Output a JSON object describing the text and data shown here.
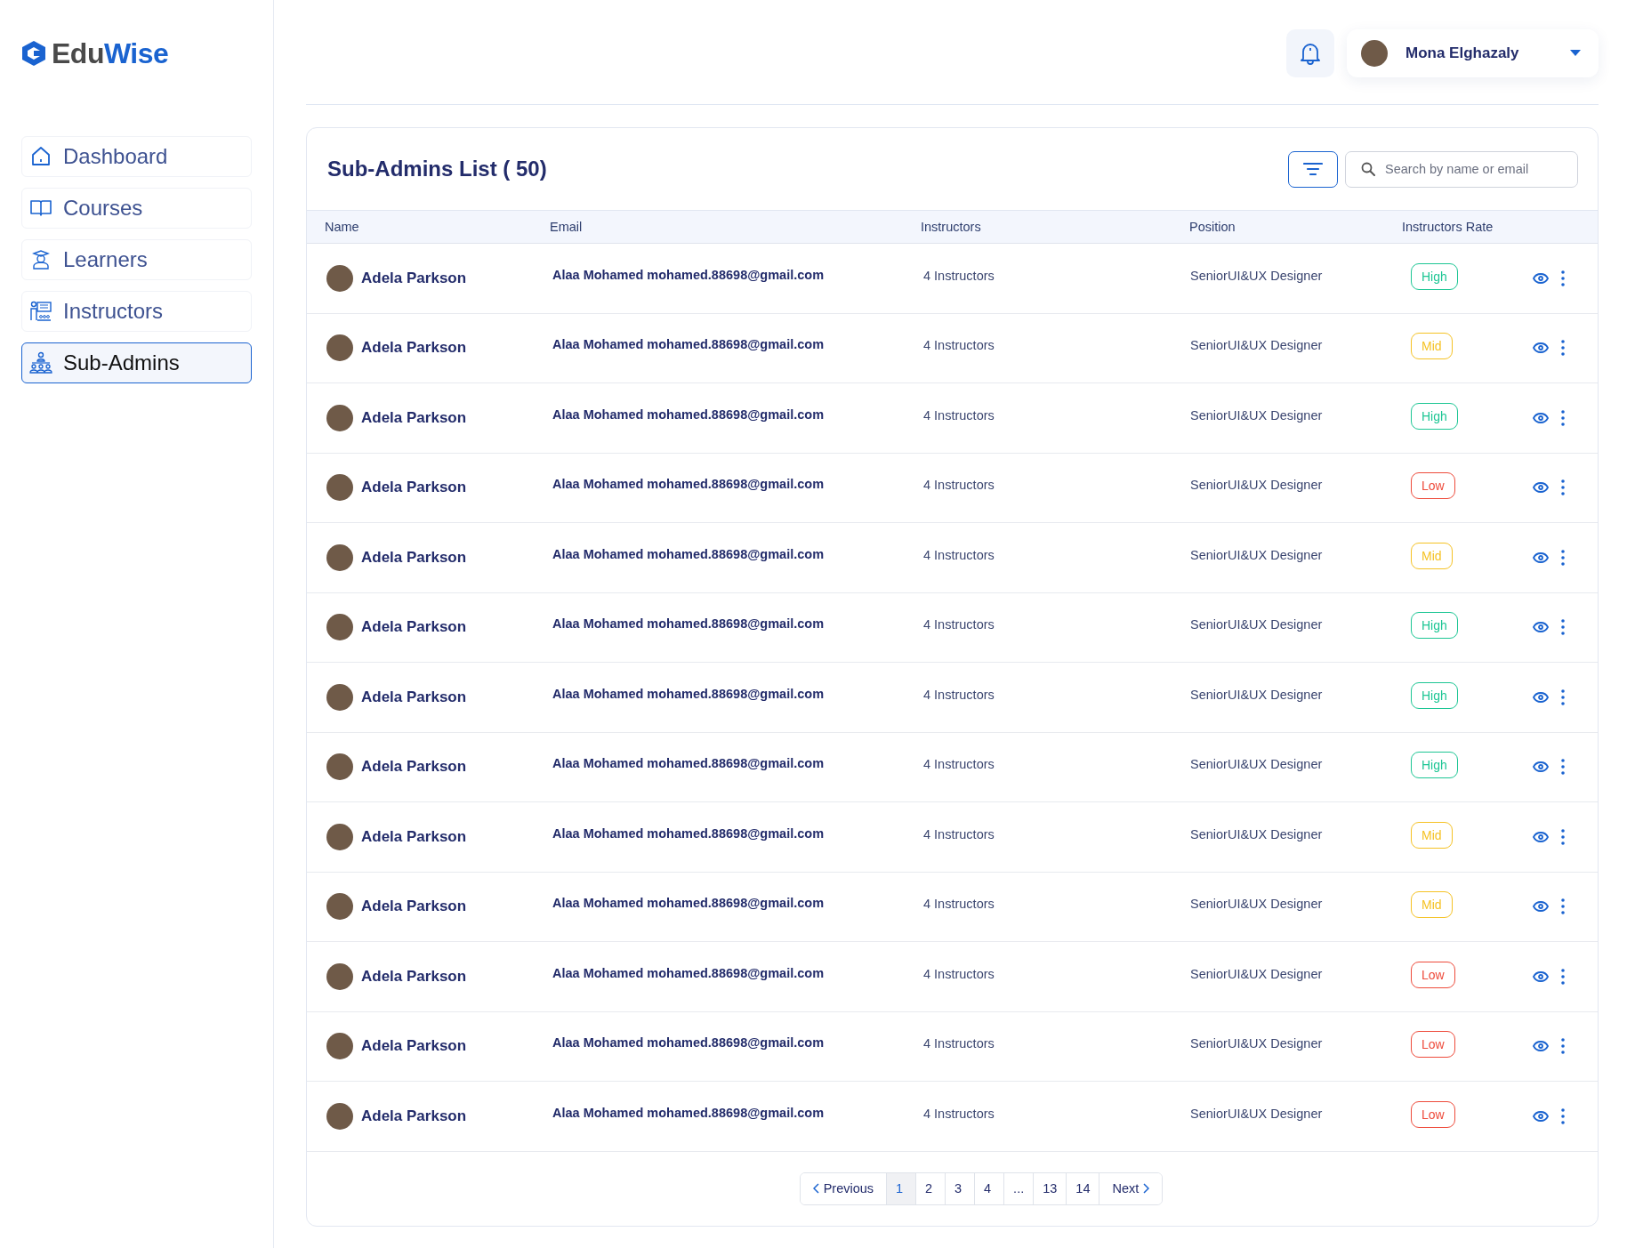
{
  "logo": {
    "part_1": "Edu",
    "part_2": "Wise"
  },
  "sidebar": {
    "items": [
      {
        "label": "Dashboard",
        "selected": false
      },
      {
        "label": "Courses",
        "selected": false
      },
      {
        "label": "Learners",
        "selected": false
      },
      {
        "label": "Instructors",
        "selected": false
      },
      {
        "label": "Sub-Admins",
        "selected": true
      }
    ]
  },
  "header": {
    "user": {
      "name": "Mona Elghazaly"
    }
  },
  "list": {
    "title": "Sub-Admins List ( 50)",
    "search": {
      "placeholder": "Search by name or email"
    }
  },
  "table": {
    "columns": [
      "Name",
      "Email",
      "Instructors",
      "Position",
      "Instructors Rate"
    ],
    "rows": [
      {
        "name": "Adela Parkson",
        "email": "Alaa Mohamed mohamed.88698@gmail.com",
        "instructors": "4 Instructors",
        "position": "SeniorUI&UX Designer",
        "rate": {
          "label": "High",
          "color": "#1dc694"
        }
      },
      {
        "name": "Adela Parkson",
        "email": "Alaa Mohamed mohamed.88698@gmail.com",
        "instructors": "4 Instructors",
        "position": "SeniorUI&UX Designer",
        "rate": {
          "label": "Mid",
          "color": "#f5c224"
        }
      },
      {
        "name": "Adela Parkson",
        "email": "Alaa Mohamed mohamed.88698@gmail.com",
        "instructors": "4 Instructors",
        "position": "SeniorUI&UX Designer",
        "rate": {
          "label": "High",
          "color": "#1dc694"
        }
      },
      {
        "name": "Adela Parkson",
        "email": "Alaa Mohamed mohamed.88698@gmail.com",
        "instructors": "4 Instructors",
        "position": "SeniorUI&UX Designer",
        "rate": {
          "label": "Low",
          "color": "#ee4b3b"
        }
      },
      {
        "name": "Adela Parkson",
        "email": "Alaa Mohamed mohamed.88698@gmail.com",
        "instructors": "4 Instructors",
        "position": "SeniorUI&UX Designer",
        "rate": {
          "label": "Mid",
          "color": "#f5c224"
        }
      },
      {
        "name": "Adela Parkson",
        "email": "Alaa Mohamed mohamed.88698@gmail.com",
        "instructors": "4 Instructors",
        "position": "SeniorUI&UX Designer",
        "rate": {
          "label": "High",
          "color": "#1dc694"
        }
      },
      {
        "name": "Adela Parkson",
        "email": "Alaa Mohamed mohamed.88698@gmail.com",
        "instructors": "4 Instructors",
        "position": "SeniorUI&UX Designer",
        "rate": {
          "label": "High",
          "color": "#1dc694"
        }
      },
      {
        "name": "Adela Parkson",
        "email": "Alaa Mohamed mohamed.88698@gmail.com",
        "instructors": "4 Instructors",
        "position": "SeniorUI&UX Designer",
        "rate": {
          "label": "High",
          "color": "#1dc694"
        }
      },
      {
        "name": "Adela Parkson",
        "email": "Alaa Mohamed mohamed.88698@gmail.com",
        "instructors": "4 Instructors",
        "position": "SeniorUI&UX Designer",
        "rate": {
          "label": "Mid",
          "color": "#f5c224"
        }
      },
      {
        "name": "Adela Parkson",
        "email": "Alaa Mohamed mohamed.88698@gmail.com",
        "instructors": "4 Instructors",
        "position": "SeniorUI&UX Designer",
        "rate": {
          "label": "Mid",
          "color": "#f5c224"
        }
      },
      {
        "name": "Adela Parkson",
        "email": "Alaa Mohamed mohamed.88698@gmail.com",
        "instructors": "4 Instructors",
        "position": "SeniorUI&UX Designer",
        "rate": {
          "label": "Low",
          "color": "#ee4b3b"
        }
      },
      {
        "name": "Adela Parkson",
        "email": "Alaa Mohamed mohamed.88698@gmail.com",
        "instructors": "4 Instructors",
        "position": "SeniorUI&UX Designer",
        "rate": {
          "label": "Low",
          "color": "#ee4b3b"
        }
      },
      {
        "name": "Adela Parkson",
        "email": "Alaa Mohamed mohamed.88698@gmail.com",
        "instructors": "4 Instructors",
        "position": "SeniorUI&UX Designer",
        "rate": {
          "label": "Low",
          "color": "#ee4b3b"
        }
      }
    ]
  },
  "pagination": {
    "previous": "Previous",
    "next": "Next",
    "pages": [
      {
        "label": "1",
        "selected": true
      },
      {
        "label": "2",
        "selected": false
      },
      {
        "label": "3",
        "selected": false
      },
      {
        "label": "4",
        "selected": false
      },
      {
        "label": "...",
        "selected": false
      },
      {
        "label": "13",
        "selected": false
      },
      {
        "label": "14",
        "selected": false
      }
    ]
  }
}
